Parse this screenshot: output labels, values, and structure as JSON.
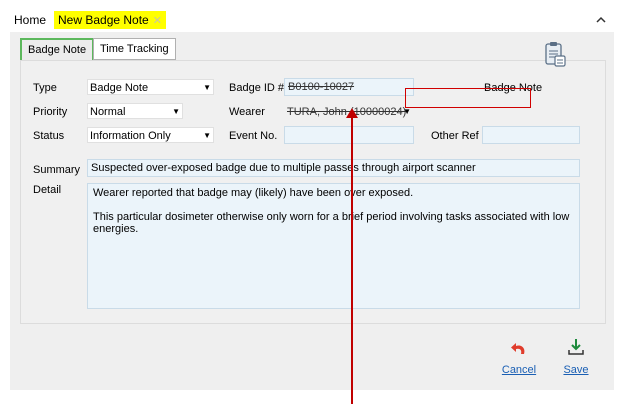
{
  "tabs": {
    "home": "Home",
    "active": "New Badge Note"
  },
  "subtabs": [
    "Badge Note",
    "Time Tracking"
  ],
  "form": {
    "type_label": "Type",
    "type_value": "Badge Note",
    "priority_label": "Priority",
    "priority_value": "Normal",
    "status_label": "Status",
    "status_value": "Information Only",
    "badge_id_label": "Badge ID #",
    "badge_id_value": "B0100-10027",
    "wearer_label": "Wearer",
    "wearer_value": "TURA, John (10000024)",
    "event_no_label": "Event No.",
    "event_no_value": "",
    "other_ref_label": "Other Ref",
    "other_ref_value": "",
    "badge_note_label": "Badge Note",
    "summary_label": "Summary",
    "summary_value": "Suspected over-exposed badge due to multiple passes through airport scanner",
    "detail_label": "Detail",
    "detail_line1": "Wearer reported that badge may (likely) have been over exposed.",
    "detail_line2": "This particular dosimeter otherwise only worn for a brief period involving tasks associated with low energies."
  },
  "actions": {
    "cancel": "Cancel",
    "save": "Save"
  },
  "colors": {
    "active_tab_bg": "#ffff00",
    "field_bg": "#ebf4fa",
    "link": "#1a5fb4",
    "annotation": "#c00000",
    "save_icon": "#1e8a3c",
    "cancel_icon": "#e03c2c"
  }
}
